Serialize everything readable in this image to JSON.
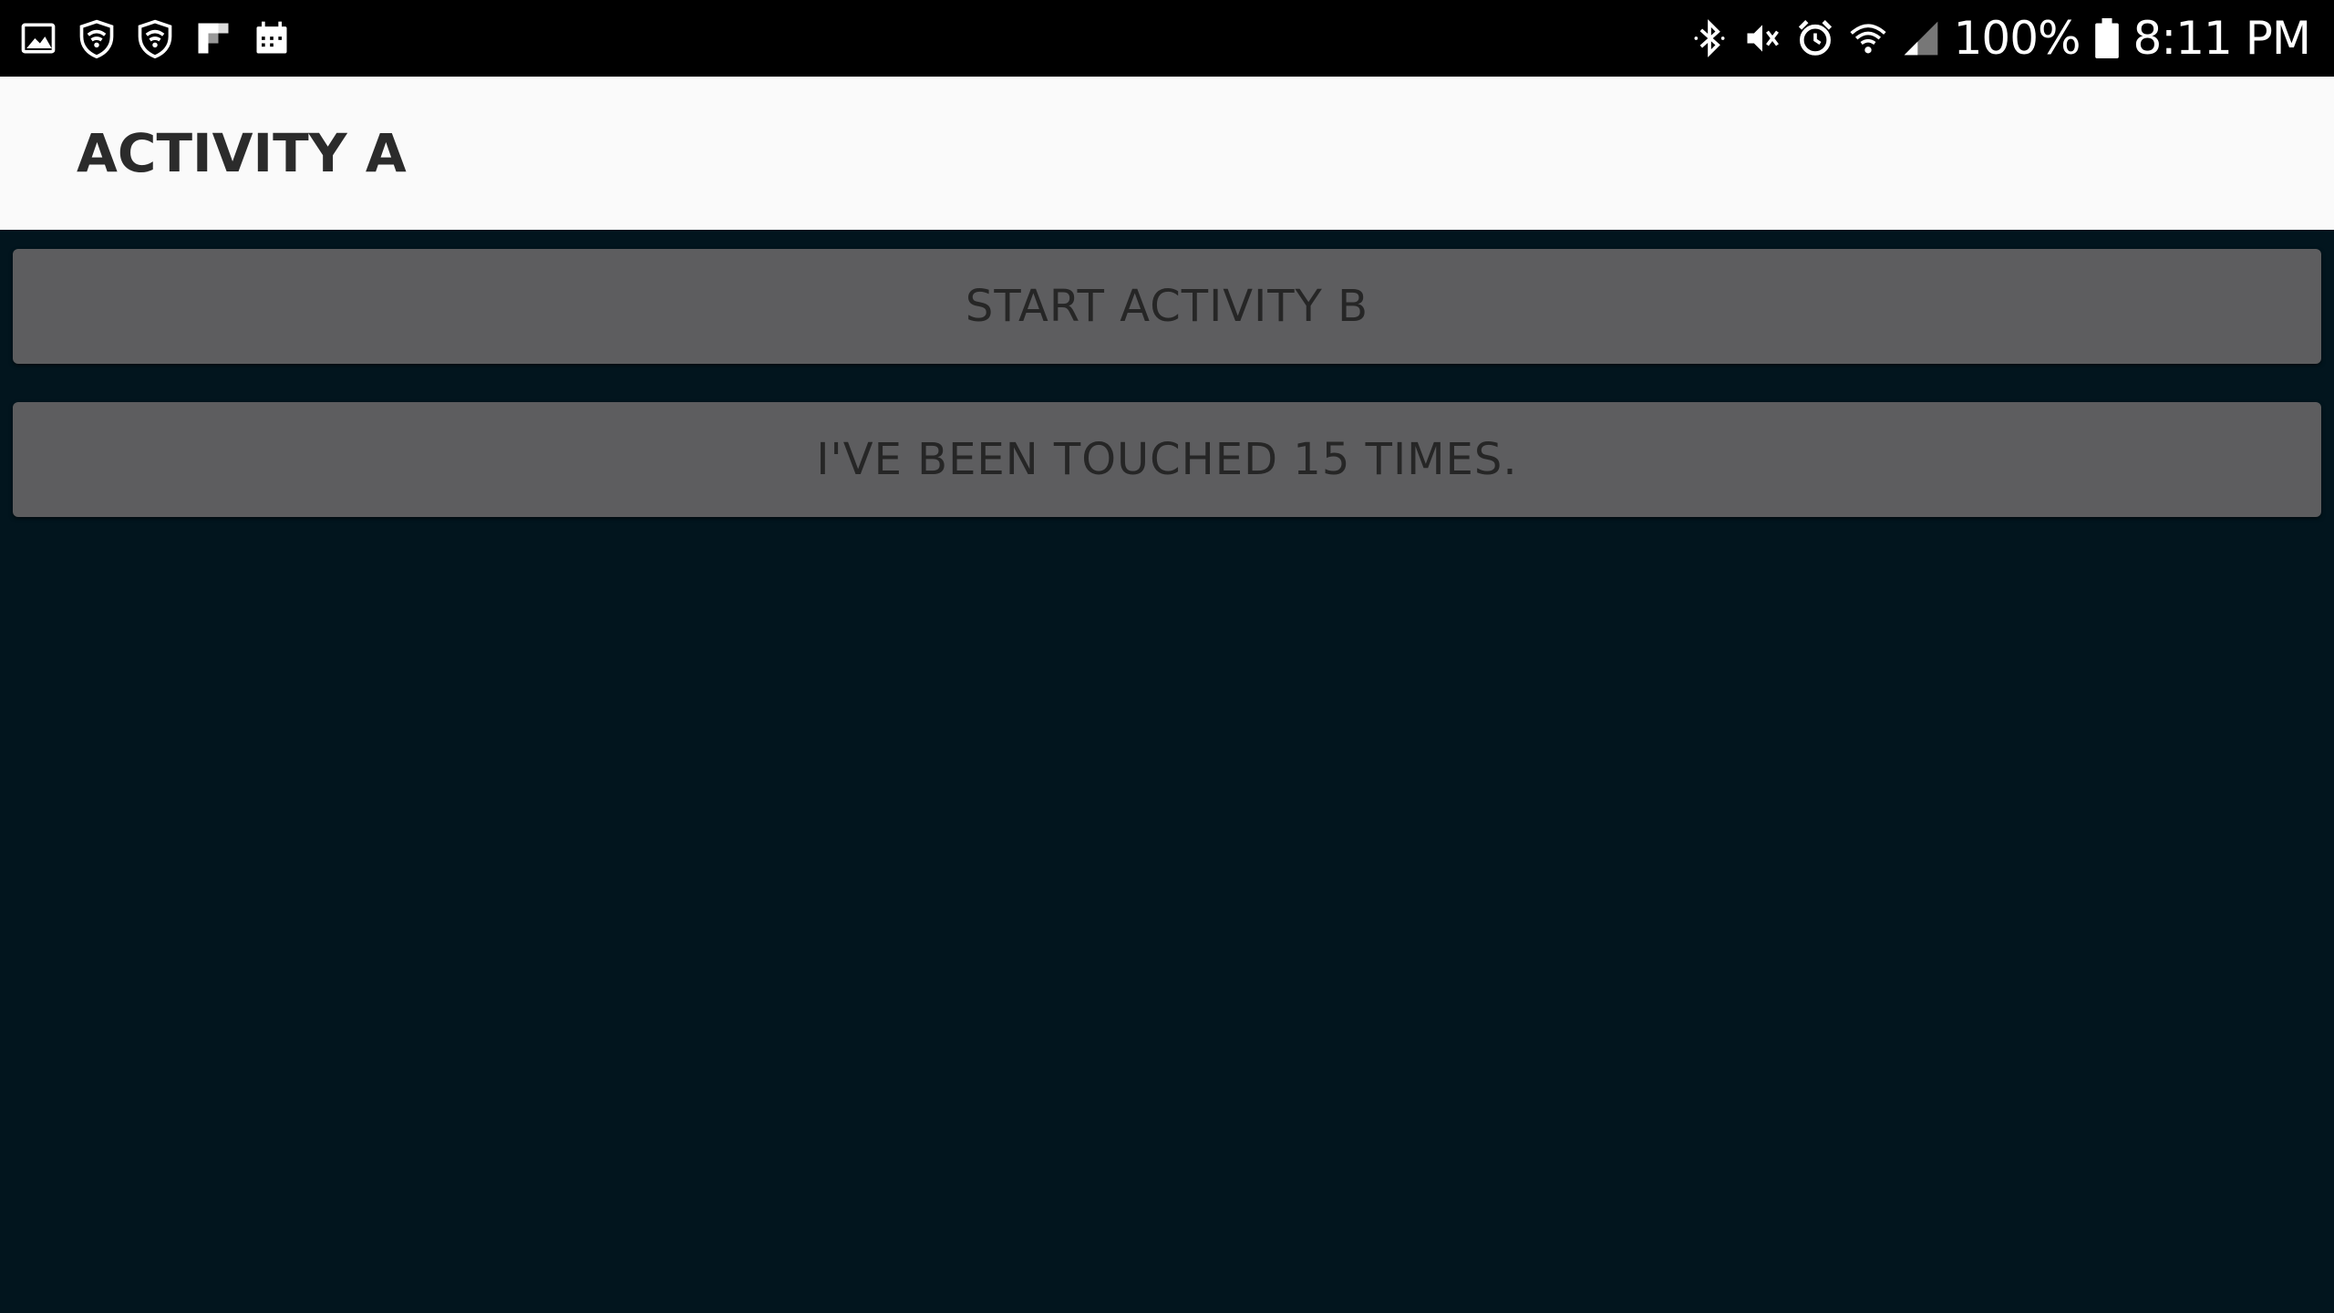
{
  "status_bar": {
    "left_icons": [
      "gallery-icon",
      "shield-wifi-icon",
      "shield-wifi-icon",
      "flipboard-icon",
      "calendar-icon"
    ],
    "right_icons": [
      "bluetooth-icon",
      "vibrate-mute-icon",
      "alarm-icon",
      "wifi-icon",
      "signal-icon",
      "battery-icon"
    ],
    "battery_percent": "100%",
    "time": "8:11 PM"
  },
  "app_bar": {
    "title": "ACTIVITY A"
  },
  "main": {
    "start_button_label": "START ACTIVITY B",
    "touch_counter_label": "I'VE BEEN TOUCHED 15 TIMES."
  },
  "colors": {
    "status_bar_bg": "#000000",
    "app_bar_bg": "#fafafa",
    "screen_bg": "#02151e",
    "button_bg": "#5d5d5f",
    "button_text": "#262626"
  }
}
